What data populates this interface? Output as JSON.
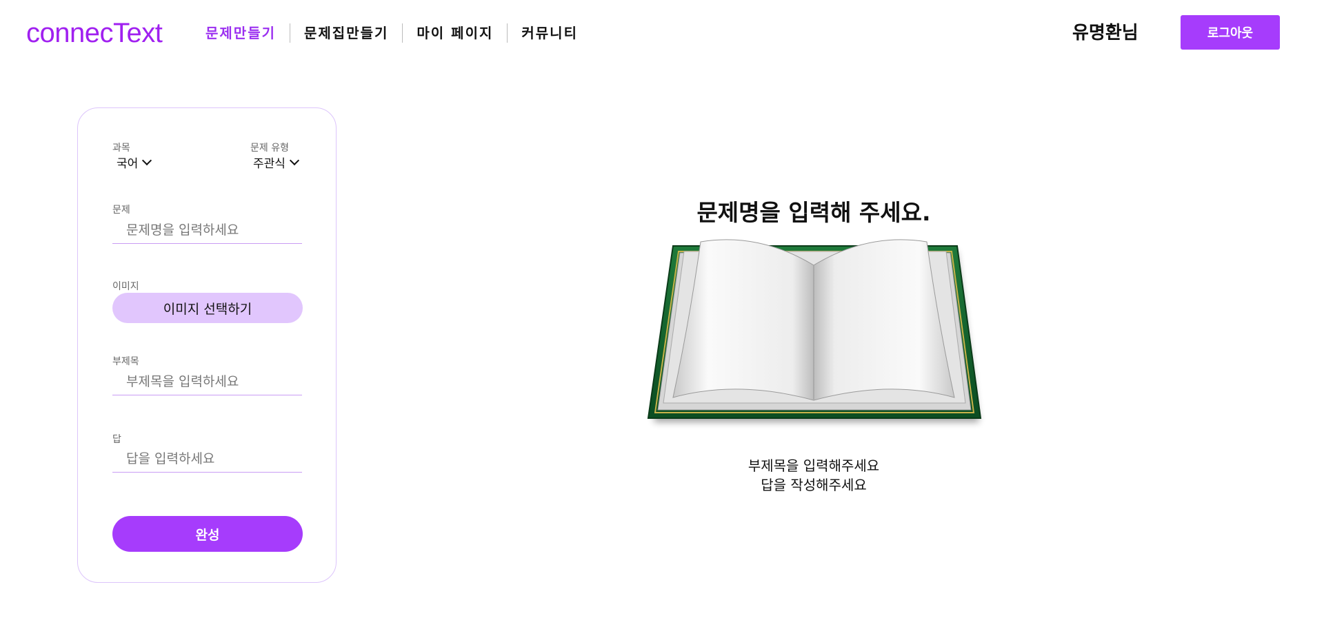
{
  "header": {
    "logo": "connecText",
    "nav": [
      "문제만들기",
      "문제집만들기",
      "마이 페이지",
      "커뮤니티"
    ],
    "active_nav": "문제만들기",
    "user_name": "유명환님",
    "logout_label": "로그아웃"
  },
  "form": {
    "subject_label": "과목",
    "subject_value": "국어",
    "type_label": "문제 유형",
    "type_value": "주관식",
    "question_label": "문제",
    "question_placeholder": "문제명을 입력하세요",
    "image_label": "이미지",
    "image_button": "이미지 선택하기",
    "subtitle_label": "부제목",
    "subtitle_placeholder": "부제목을 입력하세요",
    "answer_label": "답",
    "answer_placeholder": "답을 입력하세요",
    "submit_label": "완성"
  },
  "preview": {
    "title": "문제명을 입력해 주세요.",
    "subtitle": "부제목을 입력해주세요",
    "answer": "답을 작성해주세요",
    "image_icon": "open-book-icon"
  },
  "colors": {
    "accent": "#a63cfc",
    "accent_light": "#e1c6fd",
    "logo": "#a020f0",
    "panel_border": "#dcc4fb"
  }
}
